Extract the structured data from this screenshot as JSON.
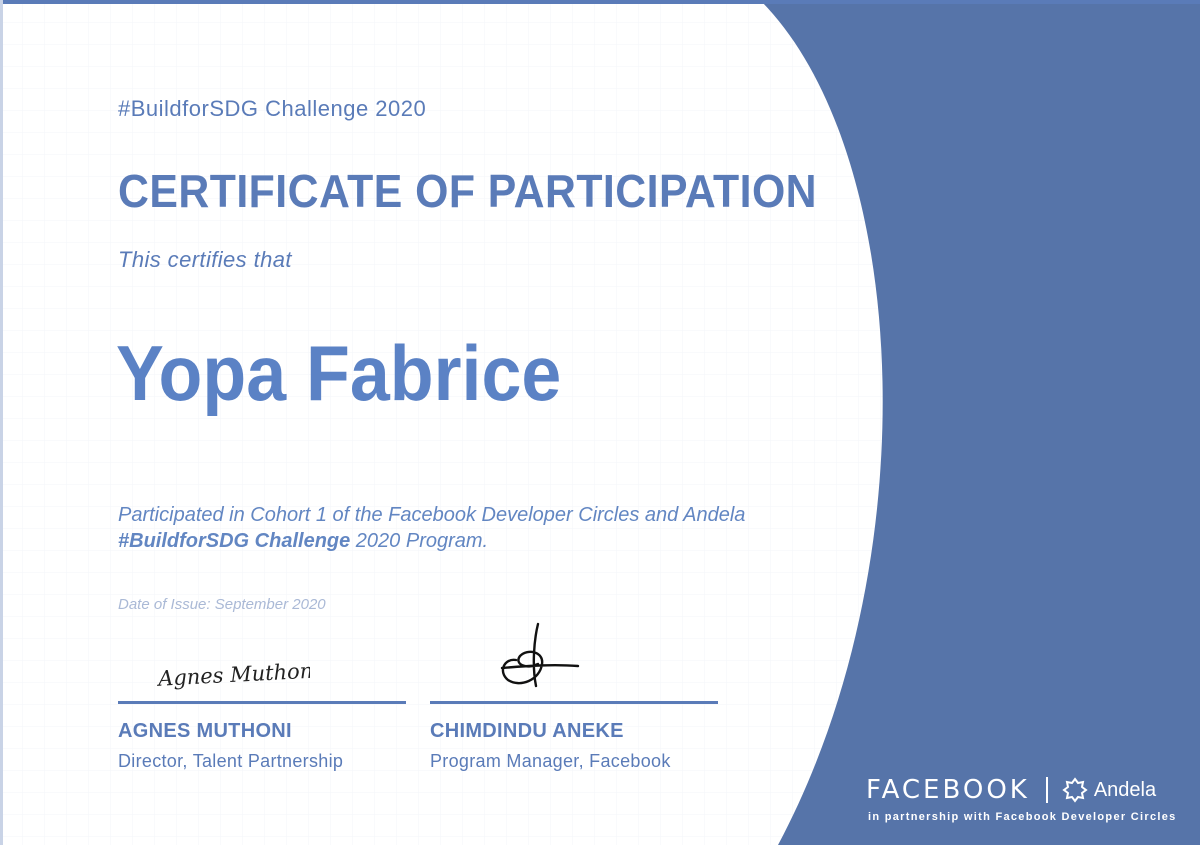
{
  "certificate": {
    "subtitle": "#BuildforSDG Challenge 2020",
    "title": "CERTIFICATE OF PARTICIPATION",
    "certifies_text": "This certifies that",
    "recipient_name": "Yopa Fabrice",
    "participation_line1": "Participated in Cohort 1 of the Facebook Developer Circles and Andela",
    "participation_line2_bold": "#BuildforSDG Challenge",
    "participation_line2_rest": " 2020 Program.",
    "issue_date": "Date of Issue: September 2020"
  },
  "signatories": [
    {
      "signature": "Agnes Muthoni",
      "name": "AGNES MUTHONI",
      "role": "Director, Talent Partnership"
    },
    {
      "name": "CHIMDINDU ANEKE",
      "role": "Program Manager, Facebook"
    }
  ],
  "branding": {
    "facebook": "FACEBOOK",
    "andela": "Andela",
    "partnership": "in partnership with Facebook Developer Circles"
  },
  "colors": {
    "primary_blue": "#5a7bb8",
    "panel_blue": "#5674a9",
    "accent_orange": "#f3bd5e",
    "background": "#ffffff"
  }
}
